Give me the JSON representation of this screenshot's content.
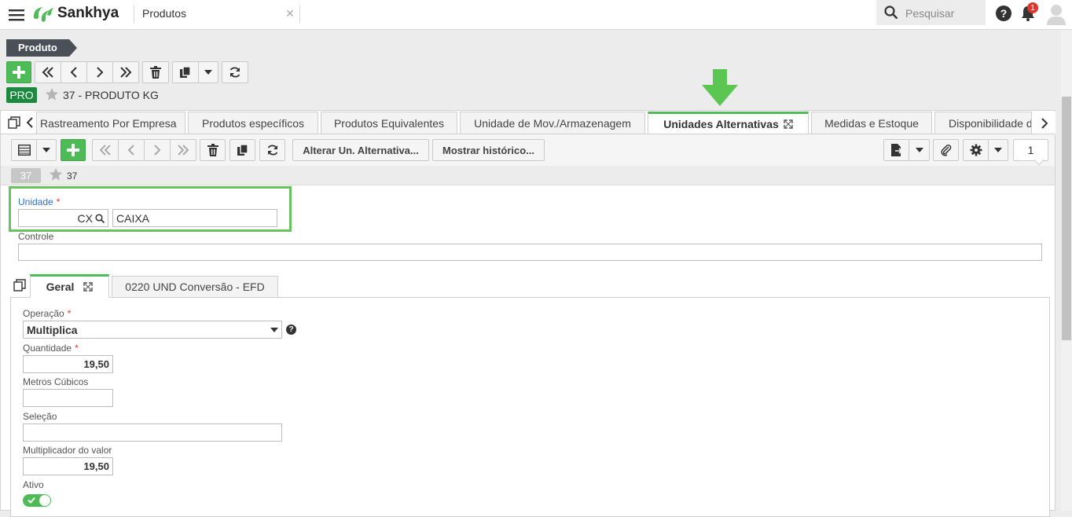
{
  "header": {
    "brand": "Sankhya",
    "app_tab": "Produtos",
    "search_placeholder": "Pesquisar",
    "notification_count": "1"
  },
  "breadcrumb": {
    "label": "Produto"
  },
  "record": {
    "badge": "PRO",
    "title": "37 - PRODUTO KG"
  },
  "tabs": [
    "Rastreamento Por Empresa",
    "Produtos específicos",
    "Produtos Equivalentes",
    "Unidade de Mov./Armazenagem",
    "Unidades Alternativas",
    "Medidas e Estoque",
    "Disponibilidade de"
  ],
  "detail_toolbar": {
    "alter_label": "Alterar Un. Alternativa...",
    "history_label": "Mostrar histórico...",
    "page_number": "1"
  },
  "subrecord": {
    "badge": "37",
    "title": "37"
  },
  "form": {
    "unidade_label": "Unidade",
    "unidade_code": "CX",
    "unidade_desc": "CAIXA",
    "controle_label": "Controle",
    "controle_value": ""
  },
  "subtabs": [
    "Geral",
    "0220 UND Conversão - EFD"
  ],
  "geral": {
    "operacao_label": "Operação",
    "operacao_value": "Multiplica",
    "quantidade_label": "Quantidade",
    "quantidade_value": "19,50",
    "metros_label": "Metros Cúbicos",
    "metros_value": "",
    "selecao_label": "Seleção",
    "selecao_value": "",
    "mult_label": "Multiplicador do valor",
    "mult_value": "19,50",
    "ativo_label": "Ativo",
    "ativo_on": true
  },
  "colors": {
    "accent": "#4dbb56",
    "badge": "#1c8a3e",
    "breadcrumb": "#4a4f58",
    "required": "#e0342c",
    "link_blue": "#2f6fcf"
  }
}
